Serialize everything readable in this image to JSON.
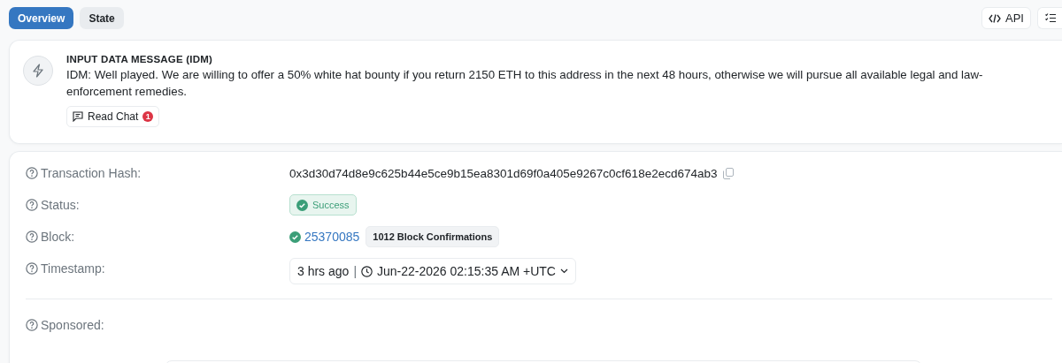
{
  "tabs": [
    {
      "label": "Overview",
      "selected": true
    },
    {
      "label": "State",
      "selected": false
    }
  ],
  "toolbar": {
    "api_button": "API"
  },
  "idm": {
    "title": "INPUT DATA MESSAGE (IDM)",
    "message": "IDM: Well played. We are willing to offer a 50% white hat bounty if you return 2150 ETH to this address in the next 48 hours, otherwise we will pursue all available legal and law-enforcement remedies.",
    "read_chat": {
      "label": "Read Chat",
      "count": "1"
    }
  },
  "details": [
    {
      "kind": "hash",
      "label": "Transaction Hash:",
      "value": "0x3d30d74d8e9c625b44e5ce9b15ea8301d69f0a405e9267c0cf618e2ecd674ab3"
    },
    {
      "kind": "status",
      "label": "Status:",
      "value": "Success"
    },
    {
      "kind": "block",
      "label": "Block:",
      "value": "25370085",
      "confirmations": "1012 Block Confirmations"
    },
    {
      "kind": "timestamp",
      "label": "Timestamp:",
      "ago": "3 hrs ago",
      "separator": "|",
      "value": "Jun-22-2026 02:15:35 AM +UTC"
    },
    {
      "kind": "divider"
    },
    {
      "kind": "sponsored",
      "label": "Sponsored:"
    }
  ]
}
